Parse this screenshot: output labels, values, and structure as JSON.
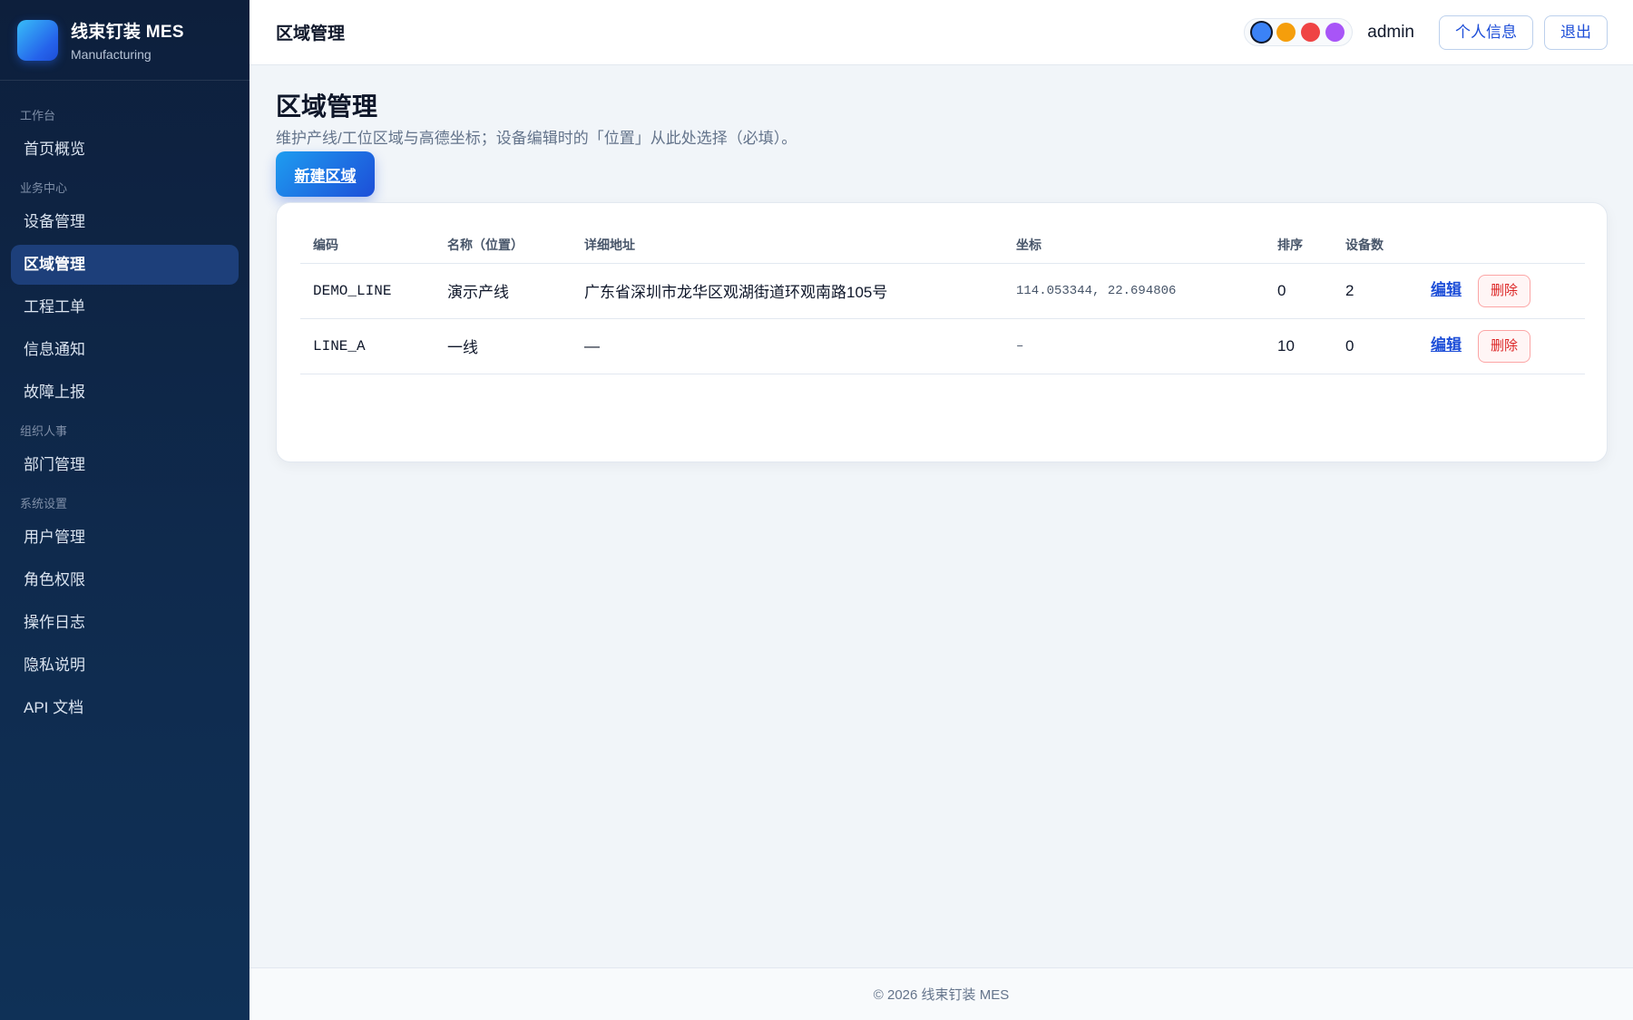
{
  "brand": {
    "title": "线束钉装 MES",
    "subtitle": "Manufacturing"
  },
  "sidebar": {
    "groups": [
      {
        "label": "工作台",
        "items": [
          {
            "label": "首页概览"
          }
        ]
      },
      {
        "label": "业务中心",
        "items": [
          {
            "label": "设备管理"
          },
          {
            "label": "区域管理",
            "active": true
          },
          {
            "label": "工程工单"
          },
          {
            "label": "信息通知"
          },
          {
            "label": "故障上报"
          }
        ]
      },
      {
        "label": "组织人事",
        "items": [
          {
            "label": "部门管理"
          }
        ]
      },
      {
        "label": "系统设置",
        "items": [
          {
            "label": "用户管理"
          },
          {
            "label": "角色权限"
          },
          {
            "label": "操作日志"
          },
          {
            "label": "隐私说明"
          },
          {
            "label": "API 文档"
          }
        ]
      }
    ]
  },
  "header": {
    "title": "区域管理",
    "theme_colors": [
      "#3b82f6",
      "#f59e0b",
      "#ef4444",
      "#a855f7"
    ],
    "active_theme": "#3b82f6",
    "username": "admin",
    "profile_label": "个人信息",
    "logout_label": "退出"
  },
  "page": {
    "title": "区域管理",
    "description": "维护产线/工位区域与高德坐标；设备编辑时的「位置」从此处选择（必填）。",
    "new_button": "新建区域"
  },
  "table": {
    "columns": [
      "编码",
      "名称（位置）",
      "详细地址",
      "坐标",
      "排序",
      "设备数",
      ""
    ],
    "rows": [
      {
        "code": "DEMO_LINE",
        "name": "演示产线",
        "address": "广东省深圳市龙华区观湖街道环观南路105号",
        "coords": "114.053344, 22.694806",
        "sort": "0",
        "device_count": "2",
        "edit": "编辑",
        "delete": "删除"
      },
      {
        "code": "LINE_A",
        "name": "一线",
        "address": "—",
        "coords": "–",
        "sort": "10",
        "device_count": "0",
        "edit": "编辑",
        "delete": "删除"
      }
    ]
  },
  "footer": {
    "text": "© 2026 线束钉装 MES"
  }
}
